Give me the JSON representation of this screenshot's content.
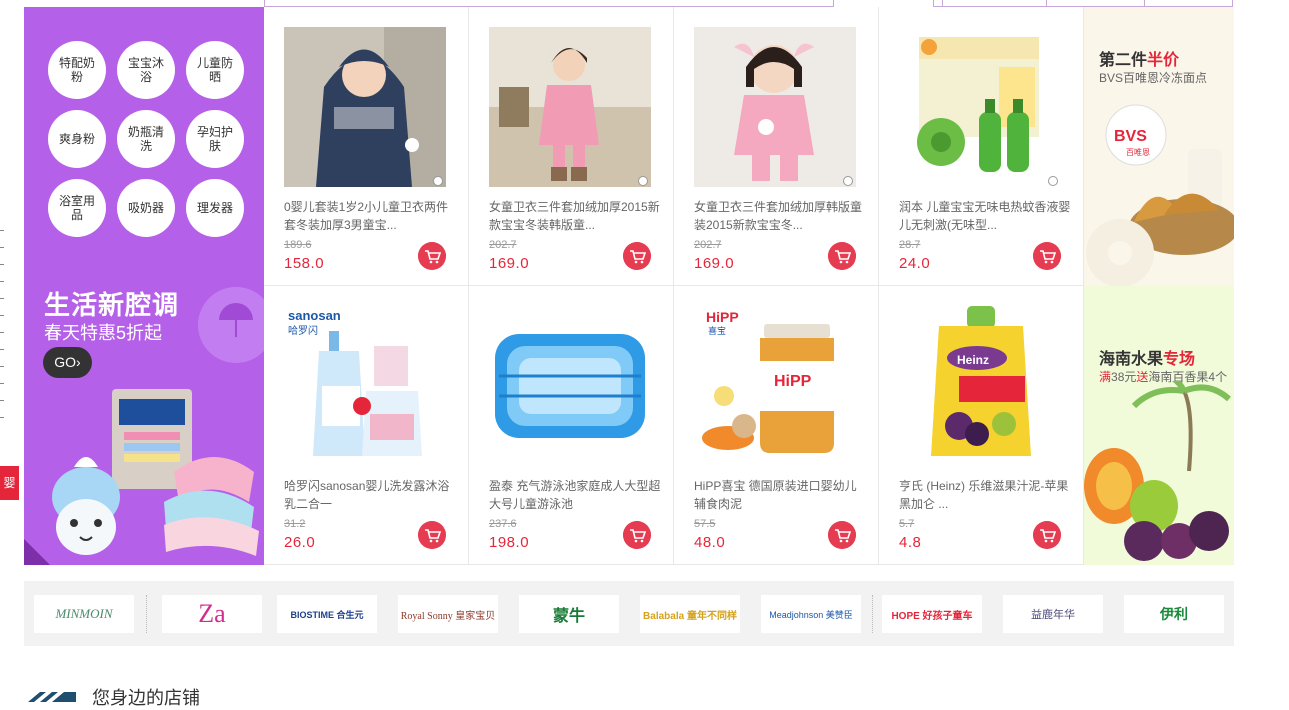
{
  "categories": [
    {
      "label": "特配奶粉"
    },
    {
      "label": "宝宝沐浴"
    },
    {
      "label": "儿童防晒"
    },
    {
      "label": "爽身粉"
    },
    {
      "label": "奶瓶清洗"
    },
    {
      "label": "孕妇护肤"
    },
    {
      "label": "浴室用品"
    },
    {
      "label": "吸奶器"
    },
    {
      "label": "理发器"
    }
  ],
  "promo": {
    "title": "生活新腔调",
    "subtitle": "春天特惠5折起",
    "go_label": "GO"
  },
  "side_tab_label": "婴",
  "products": [
    {
      "name": "0婴儿套装1岁2小儿童卫衣两件套冬装加厚3男童宝...",
      "old_price": "189.6",
      "price": "158.0"
    },
    {
      "name": "女童卫衣三件套加绒加厚2015新款宝宝冬装韩版童...",
      "old_price": "202.7",
      "price": "169.0"
    },
    {
      "name": "女童卫衣三件套加绒加厚韩版童装2015新款宝宝冬...",
      "old_price": "202.7",
      "price": "169.0"
    },
    {
      "name": "润本 儿童宝宝无味电热蚊香液婴儿无刺激(无味型...",
      "old_price": "28.7",
      "price": "24.0"
    },
    {
      "name": "哈罗闪sanosan婴儿洗发露沐浴乳二合一",
      "old_price": "31.2",
      "price": "26.0"
    },
    {
      "name": "盈泰 充气游泳池家庭成人大型超大号儿童游泳池",
      "old_price": "237.6",
      "price": "198.0"
    },
    {
      "name": "HiPP喜宝 德国原装进口婴幼儿辅食肉泥",
      "old_price": "57.5",
      "price": "48.0"
    },
    {
      "name": "亨氏 (Heinz) 乐维滋果汁泥-苹果黑加仑 ...",
      "old_price": "5.7",
      "price": "4.8"
    }
  ],
  "ads": [
    {
      "title_prefix": "第二件",
      "title_highlight": "半价",
      "subtitle": "BVS百唯恩冷冻面点",
      "logo": "BVS",
      "logo_sub": "百唯恩"
    },
    {
      "title_prefix": "海南水果",
      "title_highlight": "专场",
      "sub_highlight1": "满",
      "sub_amount": "38元",
      "sub_highlight2": "送",
      "sub_rest": "海南百香果4个"
    }
  ],
  "brands": [
    {
      "label": "MINMOIN"
    },
    {
      "label": "Za"
    },
    {
      "label": "BIOSTIME 合生元"
    },
    {
      "label": "Royal Sonny 皇家宝贝"
    },
    {
      "label": "蒙牛"
    },
    {
      "label": "Balabala 童年不同样"
    },
    {
      "label": "Meadjohnson 美赞臣"
    },
    {
      "label": "HOPE 好孩子童车"
    },
    {
      "label": "益鹿年华"
    },
    {
      "label": "伊利"
    }
  ],
  "colors": {
    "accent": "#e5263a",
    "promo_bg": "#b560e8",
    "cart_btn": "#e63c52"
  },
  "bottom_heading": "您身边的店铺"
}
